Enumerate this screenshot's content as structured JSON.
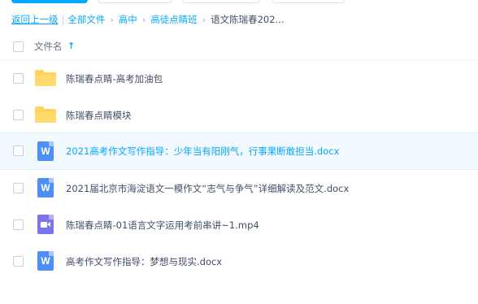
{
  "breadcrumb": {
    "back": "返回上一级",
    "items": [
      "全部文件",
      "高中",
      "高徒点睛班"
    ],
    "current": "语文陈瑞春202..."
  },
  "list_header": {
    "label": "文件名",
    "sort_icon": "arrow-up-icon"
  },
  "files": [
    {
      "name": "陈瑞春点睛-高考加油包",
      "type": "folder-icon"
    },
    {
      "name": "陈瑞春点睛模块",
      "type": "folder-icon"
    },
    {
      "name": "2021高考作文写作指导：少年当有阳刚气，行事果断敢担当.docx",
      "type": "word-doc-icon",
      "selected": true
    },
    {
      "name": "2021届北京市海淀语文一模作文“志气与争气”详细解读及范文.docx",
      "type": "word-doc-icon"
    },
    {
      "name": "陈瑞春点睛-01语言文字运用考前串讲~1.mp4",
      "type": "video-file-icon"
    },
    {
      "name": "高考作文写作指导：梦想与现实.docx",
      "type": "word-doc-icon"
    }
  ],
  "icons": {
    "doc_letter": "W"
  },
  "colors": {
    "accent": "#06a7ff",
    "folder": "#ffd25a",
    "word": "#4e8ef7",
    "video": "#7c75ec"
  }
}
